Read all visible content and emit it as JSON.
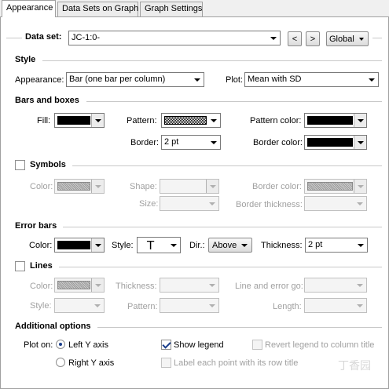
{
  "tabs": [
    "Appearance",
    "Data Sets on Graph",
    "Graph Settings"
  ],
  "dataset": {
    "label": "Data set:",
    "value": "JC-1:0-",
    "prev": "<",
    "next": ">",
    "scope": "Global"
  },
  "style": {
    "title": "Style",
    "appearance_label": "Appearance:",
    "appearance_value": "Bar (one bar per column)",
    "plot_label": "Plot:",
    "plot_value": "Mean with SD"
  },
  "bars": {
    "title": "Bars and boxes",
    "fill_label": "Fill:",
    "pattern_label": "Pattern:",
    "pattern_color_label": "Pattern color:",
    "border_label": "Border:",
    "border_value": "2 pt",
    "border_color_label": "Border color:"
  },
  "symbols": {
    "title": "Symbols",
    "color_label": "Color:",
    "shape_label": "Shape:",
    "size_label": "Size:",
    "border_color_label": "Border color:",
    "border_thickness_label": "Border thickness:"
  },
  "error_bars": {
    "title": "Error bars",
    "color_label": "Color:",
    "style_label": "Style:",
    "style_glyph": "T",
    "dir_label": "Dir.:",
    "dir_value": "Above",
    "thickness_label": "Thickness:",
    "thickness_value": "2 pt"
  },
  "lines": {
    "title": "Lines",
    "color_label": "Color:",
    "thickness_label": "Thickness:",
    "line_error_label": "Line and error go:",
    "style_label": "Style:",
    "pattern_label": "Pattern:",
    "length_label": "Length:"
  },
  "additional": {
    "title": "Additional options",
    "plot_on_label": "Plot on:",
    "left_axis": "Left Y axis",
    "right_axis": "Right Y axis",
    "show_legend": "Show legend",
    "revert_legend": "Revert legend to column title",
    "label_points": "Label each point with its row title"
  },
  "colors": {
    "black": "#000000",
    "disabled_text": "#a0a0a0",
    "check_blue": "#1a3e8c"
  },
  "watermark": "丁香园"
}
